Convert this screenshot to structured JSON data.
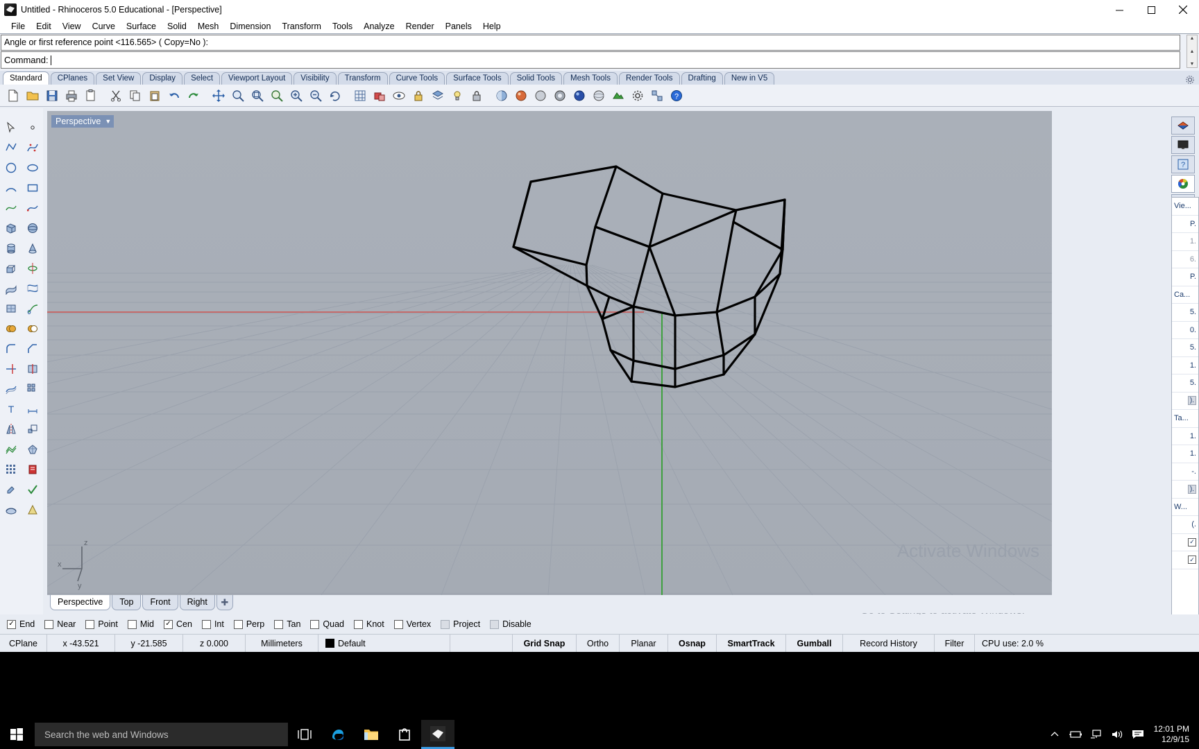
{
  "window": {
    "title": "Untitled - Rhinoceros 5.0 Educational - [Perspective]",
    "app_icon": "rhino-icon",
    "minimize_label": "─",
    "maximize_label": "☐",
    "close_label": "✕"
  },
  "menubar": {
    "items": [
      "File",
      "Edit",
      "View",
      "Curve",
      "Surface",
      "Solid",
      "Mesh",
      "Dimension",
      "Transform",
      "Tools",
      "Analyze",
      "Render",
      "Panels",
      "Help"
    ]
  },
  "command": {
    "history": "Angle or first reference point <116.565> ( Copy=No ):",
    "prompt_label": "Command:",
    "input_value": ""
  },
  "toolbar_tabs": {
    "items": [
      "Standard",
      "CPlanes",
      "Set View",
      "Display",
      "Select",
      "Viewport Layout",
      "Visibility",
      "Transform",
      "Curve Tools",
      "Surface Tools",
      "Solid Tools",
      "Mesh Tools",
      "Render Tools",
      "Drafting",
      "New in V5"
    ],
    "active": "Standard",
    "options_icon": "gear-icon"
  },
  "main_toolbar": {
    "buttons": [
      "new-file-icon",
      "open-file-icon",
      "save-file-icon",
      "print-icon",
      "copy-to-clipboard-icon",
      "cut-icon",
      "copy-icon",
      "paste-icon",
      "undo-icon",
      "redo-icon",
      "move-icon",
      "zoom-window-icon",
      "zoom-extents-icon",
      "zoom-selected-icon",
      "zoom-in-icon",
      "zoom-out-icon",
      "rotate-view-icon",
      "grid-icon",
      "hide-objects-icon",
      "show-objects-icon",
      "lock-objects-icon",
      "layer-icon",
      "light-icon",
      "lock-icon",
      "shade-view-icon",
      "render-icon",
      "ghosted-view-icon",
      "xray-view-icon",
      "render-preview-icon",
      "sphere-icon",
      "material-icon",
      "properties-icon",
      "gumball-icon",
      "help-icon"
    ]
  },
  "left_toolbar": {
    "buttons": [
      "select-arrow-icon",
      "select-point-icon",
      "polyline-icon",
      "control-point-curve-icon",
      "circle-icon",
      "ellipse-icon",
      "arc-icon",
      "rectangle-icon",
      "curve-tools-icon",
      "curve-edit-icon",
      "box-icon",
      "sphere-solid-icon",
      "cylinder-icon",
      "cone-icon",
      "extrude-icon",
      "revolve-icon",
      "surface-from-curves-icon",
      "loft-icon",
      "patch-icon",
      "sweep-icon",
      "boolean-union-icon",
      "boolean-difference-icon",
      "fillet-icon",
      "chamfer-icon",
      "trim-icon",
      "split-icon",
      "offset-icon",
      "array-icon",
      "text-icon",
      "dimension-icon",
      "mirror-icon",
      "scale-icon",
      "mesh-icon",
      "mesh-tools-icon",
      "grid-snap-icon",
      "analyze-icon",
      "paint-icon",
      "check-icon",
      "render-mesh-icon",
      "light-cone-icon"
    ]
  },
  "viewport": {
    "label": "Perspective",
    "dropdown_icon": "chevron-down-icon",
    "axis_labels": {
      "x": "x",
      "y": "y",
      "z": "z"
    },
    "watermark_line1": "Activate Windows",
    "watermark_line2": "Go to Settings to activate Windows.",
    "grid_color": "#9aa1ac",
    "background_color": "#a7adb6",
    "x_axis_color": "#cc6666",
    "y_axis_color": "#3fa03f",
    "model_color": "#000000"
  },
  "viewport_tabs": {
    "items": [
      "Perspective",
      "Top",
      "Front",
      "Right"
    ],
    "active": "Perspective",
    "add_label": "✚"
  },
  "right_panel": {
    "tabs": [
      {
        "icon": "layers-panel-icon",
        "active": false
      },
      {
        "icon": "display-panel-icon",
        "active": false
      },
      {
        "icon": "help-panel-icon",
        "active": false
      },
      {
        "icon": "properties-panel-icon",
        "active": true
      },
      {
        "icon": "settings-panel-icon",
        "active": false
      }
    ],
    "rows": [
      {
        "type": "section",
        "text": "Vie..."
      },
      {
        "type": "value",
        "text": "P."
      },
      {
        "type": "gray",
        "text": "1."
      },
      {
        "type": "gray",
        "text": "6."
      },
      {
        "type": "value",
        "text": "P."
      },
      {
        "type": "section",
        "text": "Ca..."
      },
      {
        "type": "value",
        "text": "5."
      },
      {
        "type": "value",
        "text": "0."
      },
      {
        "type": "value",
        "text": "5."
      },
      {
        "type": "value",
        "text": "1."
      },
      {
        "type": "value",
        "text": "5."
      },
      {
        "type": "chip",
        "text": ")."
      },
      {
        "type": "section",
        "text": "Ta..."
      },
      {
        "type": "value",
        "text": "1."
      },
      {
        "type": "value",
        "text": "1."
      },
      {
        "type": "value",
        "text": "-."
      },
      {
        "type": "chip",
        "text": ")."
      },
      {
        "type": "section",
        "text": "W..."
      },
      {
        "type": "value",
        "text": "(."
      },
      {
        "type": "check",
        "text": "✓"
      },
      {
        "type": "check",
        "text": "✓"
      }
    ]
  },
  "osnap_bar": {
    "items": [
      {
        "label": "End",
        "checked": true,
        "enabled": true
      },
      {
        "label": "Near",
        "checked": false,
        "enabled": true
      },
      {
        "label": "Point",
        "checked": false,
        "enabled": true
      },
      {
        "label": "Mid",
        "checked": false,
        "enabled": true
      },
      {
        "label": "Cen",
        "checked": true,
        "enabled": true
      },
      {
        "label": "Int",
        "checked": false,
        "enabled": true
      },
      {
        "label": "Perp",
        "checked": false,
        "enabled": true
      },
      {
        "label": "Tan",
        "checked": false,
        "enabled": true
      },
      {
        "label": "Quad",
        "checked": false,
        "enabled": true
      },
      {
        "label": "Knot",
        "checked": false,
        "enabled": true
      },
      {
        "label": "Vertex",
        "checked": false,
        "enabled": true
      },
      {
        "label": "Project",
        "checked": false,
        "enabled": false
      },
      {
        "label": "Disable",
        "checked": false,
        "enabled": false
      }
    ],
    "check_glyph": "✓"
  },
  "status_bar": {
    "cplane_label": "CPlane",
    "x": "x -43.521",
    "y": "y -21.585",
    "z": "z 0.000",
    "units": "Millimeters",
    "layer": "Default",
    "layer_color": "#000000",
    "toggles": [
      {
        "label": "Grid Snap",
        "active": true
      },
      {
        "label": "Ortho",
        "active": false
      },
      {
        "label": "Planar",
        "active": false
      },
      {
        "label": "Osnap",
        "active": false
      },
      {
        "label": "SmartTrack",
        "active": true
      },
      {
        "label": "Gumball",
        "active": true
      },
      {
        "label": "Record History",
        "active": false
      },
      {
        "label": "Filter",
        "active": false
      }
    ],
    "cpu": "CPU use: 2.0 %"
  },
  "taskbar": {
    "start_icon": "windows-start-icon",
    "search_placeholder": "Search the web and Windows",
    "icons": [
      {
        "name": "task-view-icon"
      },
      {
        "name": "edge-browser-icon"
      },
      {
        "name": "file-explorer-icon"
      },
      {
        "name": "store-icon"
      },
      {
        "name": "rhinoceros-app-icon"
      }
    ],
    "tray": [
      {
        "name": "show-hidden-icons-chevron-icon",
        "glyph": "∧"
      },
      {
        "name": "battery-icon"
      },
      {
        "name": "network-icon"
      },
      {
        "name": "volume-icon"
      },
      {
        "name": "action-center-icon"
      }
    ],
    "time": "12:01 PM",
    "date": "12/9/15"
  }
}
